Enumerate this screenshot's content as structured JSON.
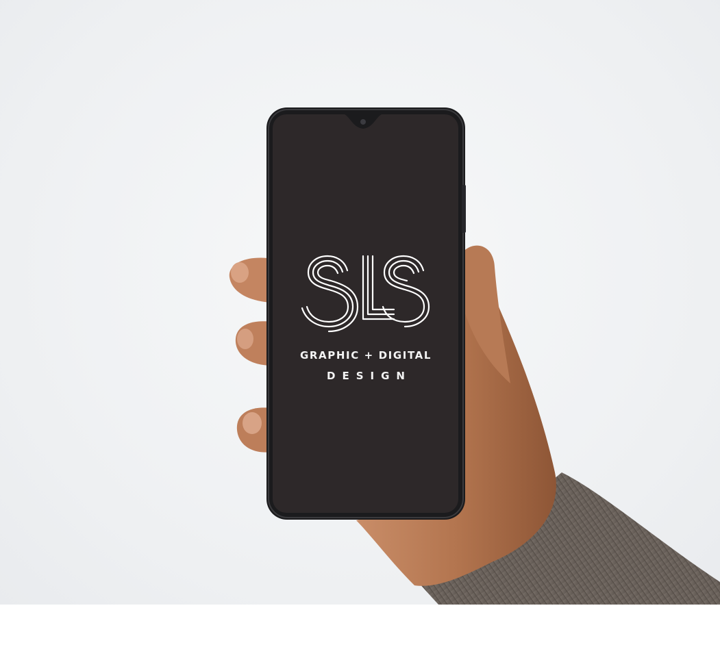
{
  "logo": {
    "wordmark": "SLS"
  },
  "screen": {
    "tagline_line1": "GRAPHIC + DIGITAL",
    "tagline_line2": "DESIGN"
  },
  "colors": {
    "background": "#eef0f2",
    "phone_screen": "#2d2829",
    "phone_frame": "#1b1b1d",
    "skin": "#b97a57",
    "sleeve": "#6d655e",
    "logo_stroke": "#ffffff"
  }
}
